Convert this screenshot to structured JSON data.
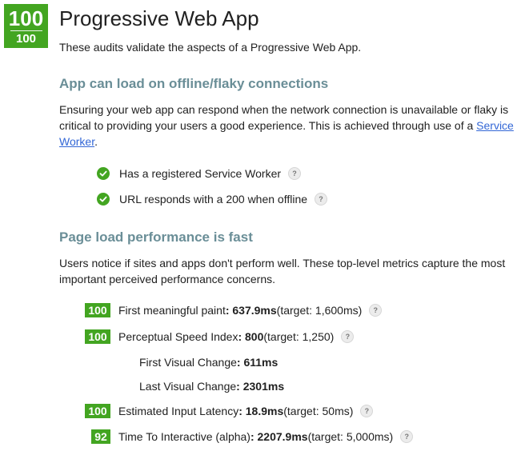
{
  "header": {
    "score": "100",
    "score_sub": "100",
    "title": "Progressive Web App",
    "intro": "These audits validate the aspects of a Progressive Web App."
  },
  "offline": {
    "heading": "App can load on offline/flaky connections",
    "para_text": "Ensuring your web app can respond when the network connection is unavailable or flaky is critical to providing your users a good experience. This is achieved through use of a ",
    "link_text": "Service Worker",
    "para_end": ".",
    "audits": [
      {
        "label": "Has a registered Service Worker"
      },
      {
        "label": "URL responds with a 200 when offline"
      }
    ]
  },
  "perf": {
    "heading": "Page load performance is fast",
    "para": "Users notice if sites and apps don't perform well. These top-level metrics capture the most important perceived performance concerns.",
    "metrics": [
      {
        "score": "100",
        "label": "First meaningful paint",
        "value": ": 637.9ms",
        "target": " (target: 1,600ms)"
      },
      {
        "score": "100",
        "label": "Perceptual Speed Index",
        "value": ": 800",
        "target": " (target: 1,250)"
      },
      {
        "score": "100",
        "label": "Estimated Input Latency",
        "value": ": 18.9ms",
        "target": " (target: 50ms)"
      },
      {
        "score": "92",
        "label": "Time To Interactive (alpha)",
        "value": ": 2207.9ms",
        "target": " (target: 5,000ms)"
      }
    ],
    "sub_metrics": [
      {
        "label": "First Visual Change",
        "value": ": 611ms"
      },
      {
        "label": "Last Visual Change",
        "value": ": 2301ms"
      }
    ]
  },
  "help_glyph": "?",
  "colors": {
    "pass": "#43a521",
    "section_heading": "#6a8e97",
    "link": "#3367d6"
  }
}
